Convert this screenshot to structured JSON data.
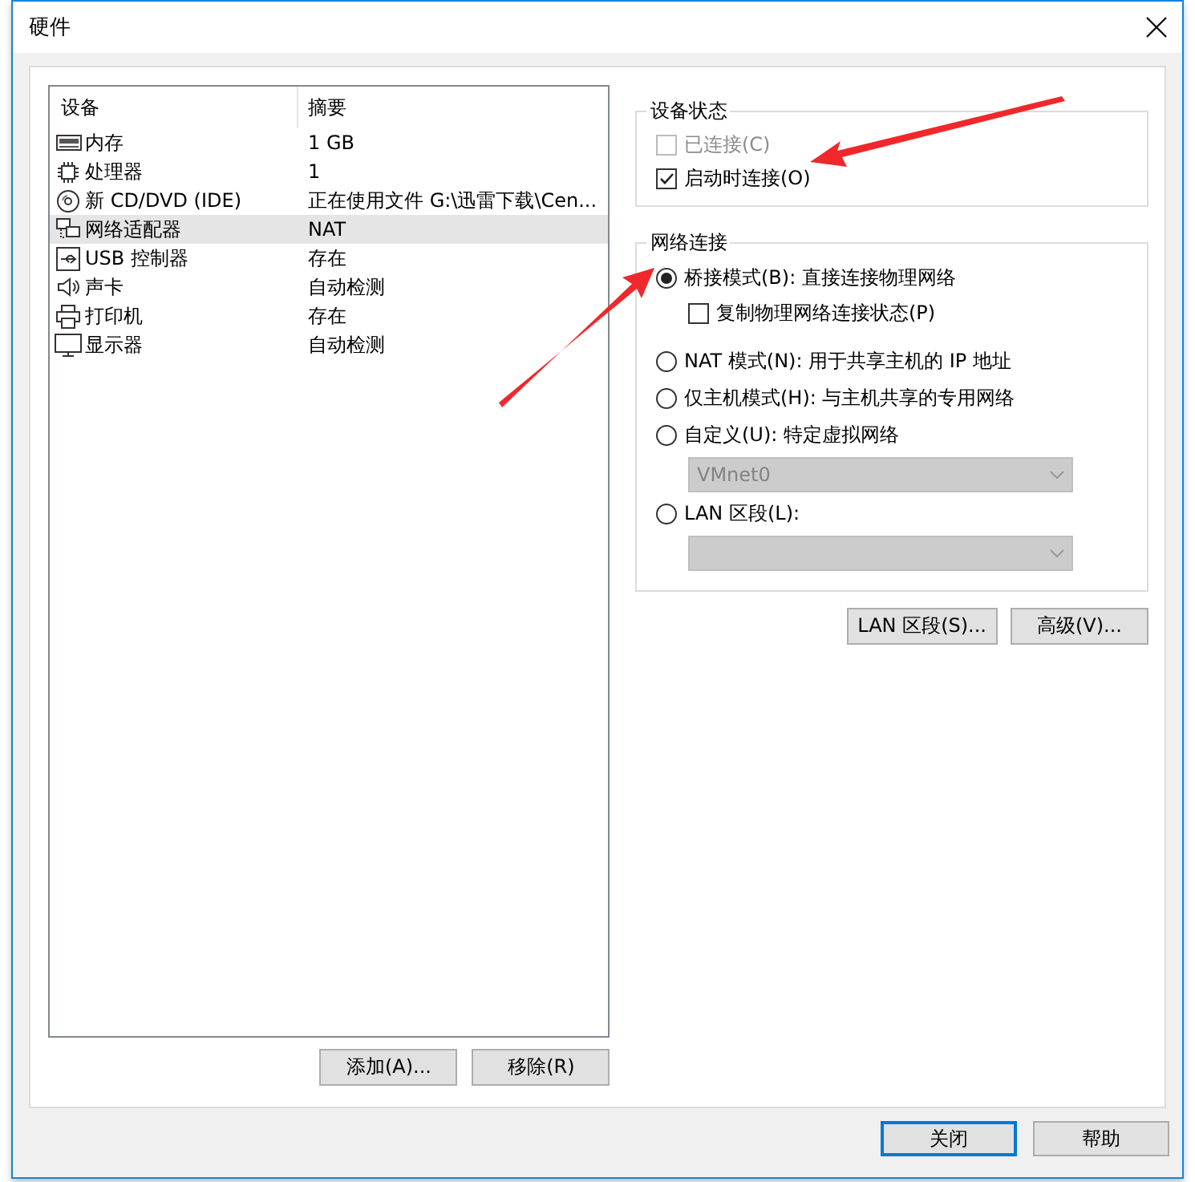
{
  "window": {
    "title": "硬件"
  },
  "device_list": {
    "columns": [
      "设备",
      "摘要"
    ],
    "rows": [
      {
        "kind": "memory",
        "device": "内存",
        "summary": "1 GB",
        "selected": false
      },
      {
        "kind": "cpu",
        "device": "处理器",
        "summary": "1",
        "selected": false
      },
      {
        "kind": "disc",
        "device": "新 CD/DVD (IDE)",
        "summary": "正在使用文件 G:\\迅雷下载\\Cen...",
        "selected": false
      },
      {
        "kind": "network",
        "device": "网络适配器",
        "summary": "NAT",
        "selected": true
      },
      {
        "kind": "usb",
        "device": "USB 控制器",
        "summary": "存在",
        "selected": false
      },
      {
        "kind": "sound",
        "device": "声卡",
        "summary": "自动检测",
        "selected": false
      },
      {
        "kind": "printer",
        "device": "打印机",
        "summary": "存在",
        "selected": false
      },
      {
        "kind": "display",
        "device": "显示器",
        "summary": "自动检测",
        "selected": false
      }
    ]
  },
  "list_buttons": [
    "添加(A)...",
    "移除(R)"
  ],
  "device_status": {
    "title": "设备状态",
    "options": [
      {
        "label": "已连接(C)",
        "checked": false,
        "disabled": true
      },
      {
        "label": "启动时连接(O)",
        "checked": true,
        "disabled": false
      }
    ]
  },
  "network": {
    "title": "网络连接",
    "items": [
      {
        "kind": "radio",
        "label": "桥接模式(B): 直接连接物理网络",
        "selected": true
      },
      {
        "kind": "checkbox",
        "label": "复制物理网络连接状态(P)",
        "checked": false
      },
      {
        "kind": "radio",
        "label": "NAT 模式(N): 用于共享主机的 IP 地址",
        "selected": false
      },
      {
        "kind": "radio",
        "label": "仅主机模式(H): 与主机共享的专用网络",
        "selected": false
      },
      {
        "kind": "radio",
        "label": "自定义(U): 特定虚拟网络",
        "selected": false
      },
      {
        "kind": "dropdown",
        "value": "VMnet0",
        "disabled": true
      },
      {
        "kind": "radio",
        "label": "LAN 区段(L):",
        "selected": false
      },
      {
        "kind": "dropdown",
        "disabled": true
      }
    ]
  },
  "network_buttons": [
    "LAN 区段(S)...",
    "高级(V)..."
  ],
  "dialog_buttons": [
    {
      "label": "关闭",
      "default": true
    },
    {
      "label": "帮助",
      "default": false
    }
  ]
}
